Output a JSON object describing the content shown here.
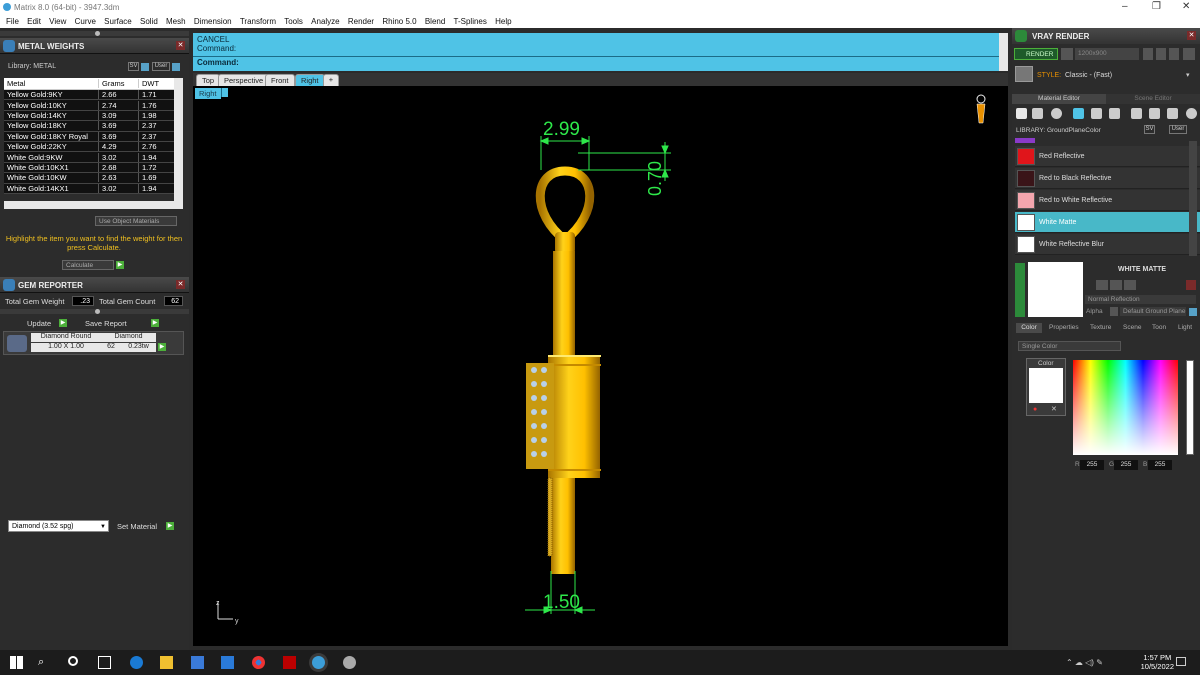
{
  "window": {
    "title": "Matrix 8.0 (64-bit) - 3947.3dm"
  },
  "menu": [
    "File",
    "Edit",
    "View",
    "Curve",
    "Surface",
    "Solid",
    "Mesh",
    "Dimension",
    "Transform",
    "Tools",
    "Analyze",
    "Render",
    "Rhino 5.0",
    "Blend",
    "T-Splines",
    "Help"
  ],
  "metal_weights": {
    "title": "METAL WEIGHTS",
    "library_label": "Library: METAL",
    "sv_label": "SV",
    "user_label": "User",
    "columns": [
      "Metal",
      "Grams",
      "DWT"
    ],
    "rows": [
      [
        "Yellow Gold:9KY",
        "2.66",
        "1.71"
      ],
      [
        "Yellow Gold:10KY",
        "2.74",
        "1.76"
      ],
      [
        "Yellow Gold:14KY",
        "3.09",
        "1.98"
      ],
      [
        "Yellow Gold:18KY",
        "3.69",
        "2.37"
      ],
      [
        "Yellow Gold:18KY Royal",
        "3.69",
        "2.37"
      ],
      [
        "Yellow Gold:22KY",
        "4.29",
        "2.76"
      ],
      [
        "White Gold:9KW",
        "3.02",
        "1.94"
      ],
      [
        "White Gold:10KX1",
        "2.68",
        "1.72"
      ],
      [
        "White Gold:10KW",
        "2.63",
        "1.69"
      ],
      [
        "White Gold:14KX1",
        "3.02",
        "1.94"
      ]
    ],
    "use_object_materials": "Use Object Materials",
    "hint": "Highlight the item you want to find the weight for then press Calculate.",
    "calculate_label": "Calculate"
  },
  "gem_reporter": {
    "title": "GEM REPORTER",
    "total_weight_label": "Total Gem Weight",
    "total_weight_value": ".23",
    "total_count_label": "Total Gem Count",
    "total_count_value": "62",
    "update_label": "Update",
    "save_report_label": "Save Report",
    "gem": {
      "shape": "Diamond Round",
      "material": "Diamond",
      "size": "1.00 X 1.00",
      "count": "62",
      "weight": "0.23tw"
    },
    "material_select": "Diamond    (3.52 spg)",
    "set_material_label": "Set Material"
  },
  "command": {
    "line1": "CANCEL",
    "line2": "Command:",
    "prompt": "Command:"
  },
  "viewport_tabs": [
    "Top",
    "Perspective",
    "Front",
    "Right"
  ],
  "active_tab": "Right",
  "viewport_label": "Right",
  "dimensions": {
    "top_width": "2.99",
    "bail_height": "0.70",
    "bottom_width": "1.50"
  },
  "axis": {
    "vertical": "z",
    "horizontal": "y"
  },
  "vray": {
    "title": "VRAY RENDER",
    "render_label": "RENDER",
    "resolution": "1200x900",
    "style_label": "STYLE:",
    "style_value": "Classic - (Fast)",
    "tabs": [
      "Material Editor",
      "Scene Editor"
    ],
    "library_label": "LIBRARY: GroundPlaneColor",
    "materials": [
      {
        "name": "Red Reflective",
        "color": "#e0151b"
      },
      {
        "name": "Red to Black Reflective",
        "color": "#3a1418"
      },
      {
        "name": "Red to White Reflective",
        "color": "#f4a6ae"
      },
      {
        "name": "White Matte",
        "color": "#ffffff"
      },
      {
        "name": "White Reflective Blur",
        "color": "#ffffff"
      }
    ],
    "selected_material": "WHITE MATTE",
    "reflection": "Normal Reflection",
    "alpha_label": "Alpha",
    "ground_plane": "Default Ground Plane",
    "prop_tabs": [
      "Color",
      "Properties",
      "Texture",
      "Scene",
      "Toon",
      "Light"
    ],
    "color_mode": "Single Color",
    "color_label": "Color",
    "rgb": {
      "r_label": "R",
      "r": "255",
      "g_label": "G",
      "g": "255",
      "b_label": "B",
      "b": "255"
    }
  },
  "taskbar": {
    "time": "1:57 PM",
    "date": "10/5/2022"
  },
  "colors": {
    "accent": "#4fc3e6",
    "gold": "#ffc400",
    "dim_green": "#2ee84a"
  }
}
